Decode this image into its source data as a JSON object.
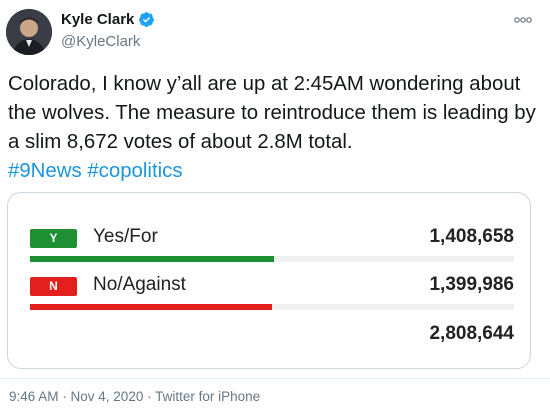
{
  "author": {
    "name": "Kyle Clark",
    "handle": "@KyleClark",
    "verified_icon": "verified-badge-icon"
  },
  "tweet": {
    "text": "Colorado, I know y’all are up at 2:45AM wondering about the wolves. The measure to reintroduce them is leading by a slim 8,672 votes of about 2.8M total.",
    "hashtags": "#9News #copolitics"
  },
  "results": {
    "options": [
      {
        "badge": "Y",
        "label": "Yes/For",
        "value": "1,408,658",
        "share": 0.5015,
        "color": "#1f8f34"
      },
      {
        "badge": "N",
        "label": "No/Against",
        "value": "1,399,986",
        "share": 0.4985,
        "color": "#e4201f"
      }
    ],
    "total": "2,808,644"
  },
  "footer": {
    "time": "9:46 AM",
    "date": "Nov 4, 2020",
    "source": "Twitter for iPhone"
  }
}
